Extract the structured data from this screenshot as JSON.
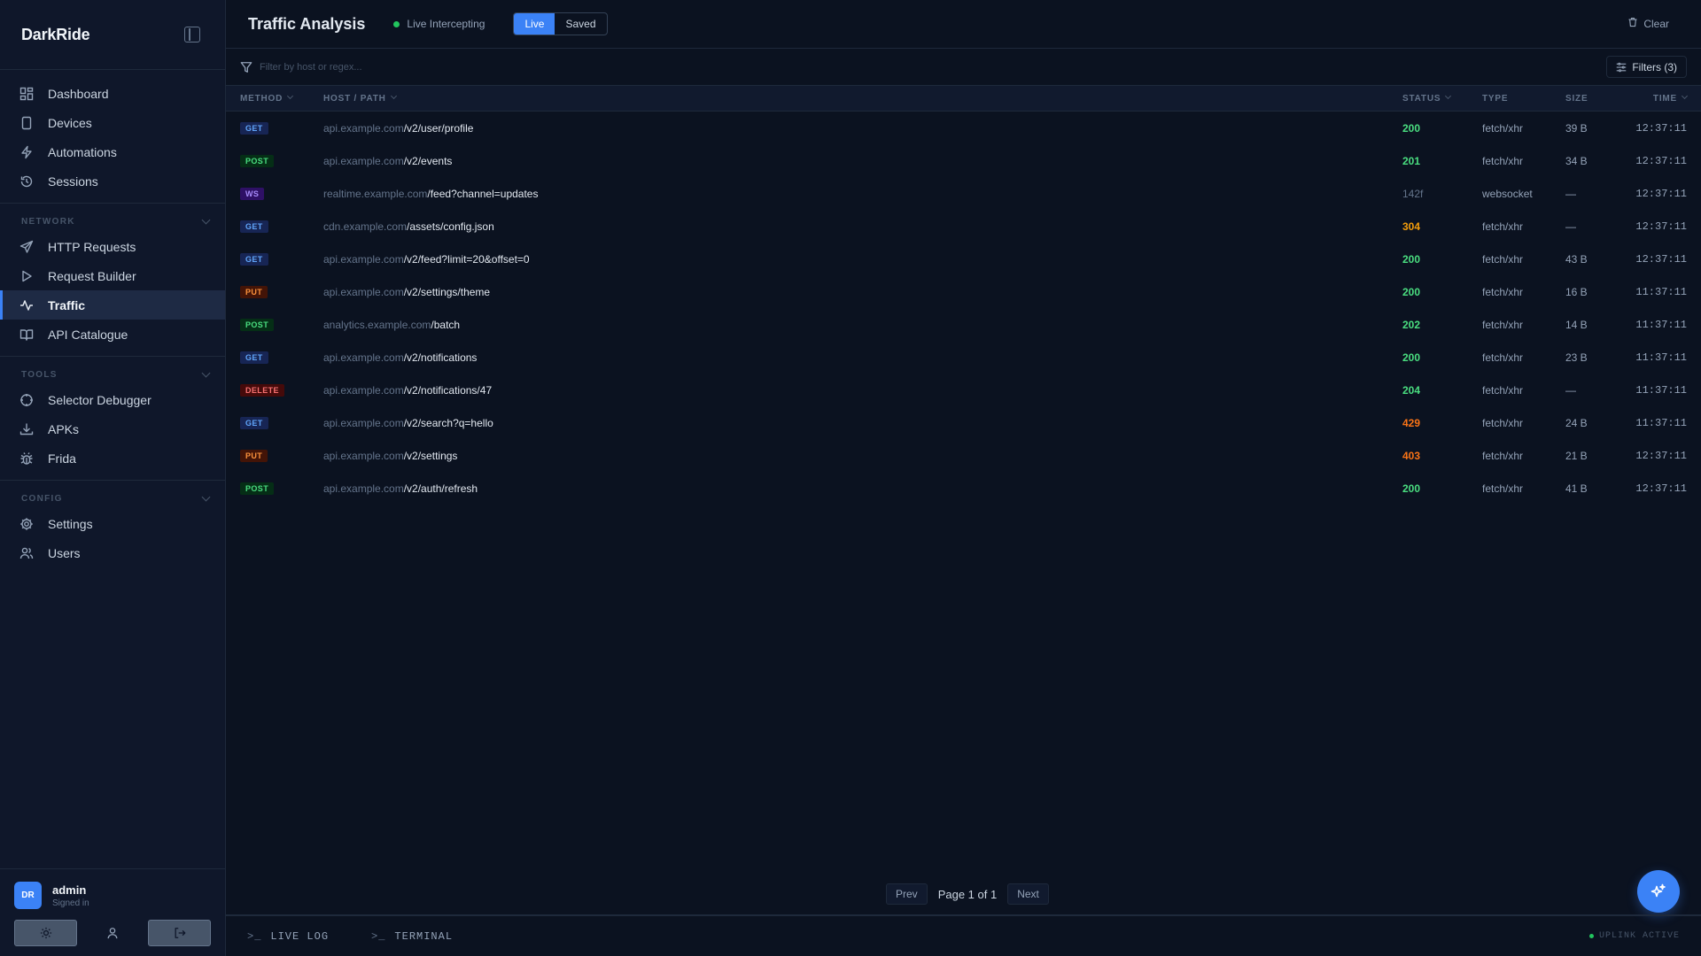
{
  "sidebar": {
    "brand": "DarkRide",
    "main_items": [
      {
        "label": "Dashboard",
        "icon": "grid-icon"
      },
      {
        "label": "Devices",
        "icon": "phone-icon"
      },
      {
        "label": "Automations",
        "icon": "bolt-icon"
      },
      {
        "label": "Sessions",
        "icon": "history-icon"
      }
    ],
    "sections": [
      {
        "title": "NETWORK",
        "items": [
          {
            "label": "HTTP Requests",
            "icon": "send-icon"
          },
          {
            "label": "Request Builder",
            "icon": "play-icon"
          },
          {
            "label": "Traffic",
            "icon": "activity-icon",
            "active": true
          },
          {
            "label": "API Catalogue",
            "icon": "book-icon"
          }
        ]
      },
      {
        "title": "TOOLS",
        "items": [
          {
            "label": "Selector Debugger",
            "icon": "crosshair-icon"
          },
          {
            "label": "APKs",
            "icon": "download-icon"
          },
          {
            "label": "Frida",
            "icon": "bug-icon"
          }
        ]
      },
      {
        "title": "CONFIG",
        "items": [
          {
            "label": "Settings",
            "icon": "gear-icon"
          },
          {
            "label": "Users",
            "icon": "users-icon"
          }
        ]
      }
    ],
    "user": {
      "initials": "DR",
      "name": "admin",
      "status": "Signed in"
    }
  },
  "topbar": {
    "title": "Traffic Analysis",
    "live_status": "Live Intercepting",
    "mode_live": "Live",
    "mode_saved": "Saved",
    "clear_label": "Clear"
  },
  "filterbar": {
    "placeholder": "Filter by host or regex...",
    "filters_label": "Filters (3)"
  },
  "table": {
    "headers": {
      "method": "METHOD",
      "host": "HOST / PATH",
      "status": "STATUS",
      "type": "TYPE",
      "size": "SIZE",
      "time": "TIME"
    },
    "rows": [
      {
        "method": "GET",
        "host": "api.example.com",
        "path": "/v2/user/profile",
        "status": "200",
        "type": "fetch/xhr",
        "size": "39 B",
        "time": "12:37:11"
      },
      {
        "method": "POST",
        "host": "api.example.com",
        "path": "/v2/events",
        "status": "201",
        "type": "fetch/xhr",
        "size": "34 B",
        "time": "12:37:11"
      },
      {
        "method": "WS",
        "host": "realtime.example.com",
        "path": "/feed?channel=updates",
        "status": "142f",
        "type": "websocket",
        "size": "—",
        "time": "12:37:11"
      },
      {
        "method": "GET",
        "host": "cdn.example.com",
        "path": "/assets/config.json",
        "status": "304",
        "type": "fetch/xhr",
        "size": "—",
        "time": "12:37:11"
      },
      {
        "method": "GET",
        "host": "api.example.com",
        "path": "/v2/feed?limit=20&offset=0",
        "status": "200",
        "type": "fetch/xhr",
        "size": "43 B",
        "time": "12:37:11"
      },
      {
        "method": "PUT",
        "host": "api.example.com",
        "path": "/v2/settings/theme",
        "status": "200",
        "type": "fetch/xhr",
        "size": "16 B",
        "time": "11:37:11"
      },
      {
        "method": "POST",
        "host": "analytics.example.com",
        "path": "/batch",
        "status": "202",
        "type": "fetch/xhr",
        "size": "14 B",
        "time": "11:37:11"
      },
      {
        "method": "GET",
        "host": "api.example.com",
        "path": "/v2/notifications",
        "status": "200",
        "type": "fetch/xhr",
        "size": "23 B",
        "time": "11:37:11"
      },
      {
        "method": "DELETE",
        "host": "api.example.com",
        "path": "/v2/notifications/47",
        "status": "204",
        "type": "fetch/xhr",
        "size": "—",
        "time": "11:37:11"
      },
      {
        "method": "GET",
        "host": "api.example.com",
        "path": "/v2/search?q=hello",
        "status": "429",
        "type": "fetch/xhr",
        "size": "24 B",
        "time": "11:37:11"
      },
      {
        "method": "PUT",
        "host": "api.example.com",
        "path": "/v2/settings",
        "status": "403",
        "type": "fetch/xhr",
        "size": "21 B",
        "time": "12:37:11"
      },
      {
        "method": "POST",
        "host": "api.example.com",
        "path": "/v2/auth/refresh",
        "status": "200",
        "type": "fetch/xhr",
        "size": "41 B",
        "time": "12:37:11"
      }
    ]
  },
  "pager": {
    "prev": "Prev",
    "page_text": "Page 1 of 1",
    "next": "Next"
  },
  "bottombar": {
    "live_log": "LIVE LOG",
    "terminal": "TERMINAL",
    "uplink": "UPLINK ACTIVE"
  },
  "colors": {
    "accent": "#3b82f6",
    "ok": "#4ade80",
    "warn": "#f59e0b",
    "error": "#f97316",
    "background": "#0b1220"
  }
}
